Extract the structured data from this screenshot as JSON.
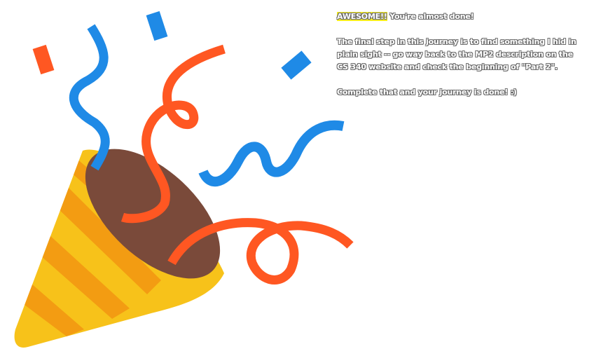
{
  "message": {
    "exclamation": "AWESOME!!",
    "headline": "You're almost done!",
    "body": "The final step in this journey is to find something I hid in plain sight -- go way back to the MP2 description on the CS 340 website and check the beginning of \"Part 2\".",
    "closing": "Complete that and your journey is done! :)"
  },
  "colors": {
    "confetti_blue": "#1f8ae6",
    "confetti_orange": "#ff5722",
    "cone_yellow": "#f7c21a",
    "cone_stripe": "#f39c12",
    "cone_mouth": "#7a4a3a",
    "highlight": "#f7ee1e"
  }
}
